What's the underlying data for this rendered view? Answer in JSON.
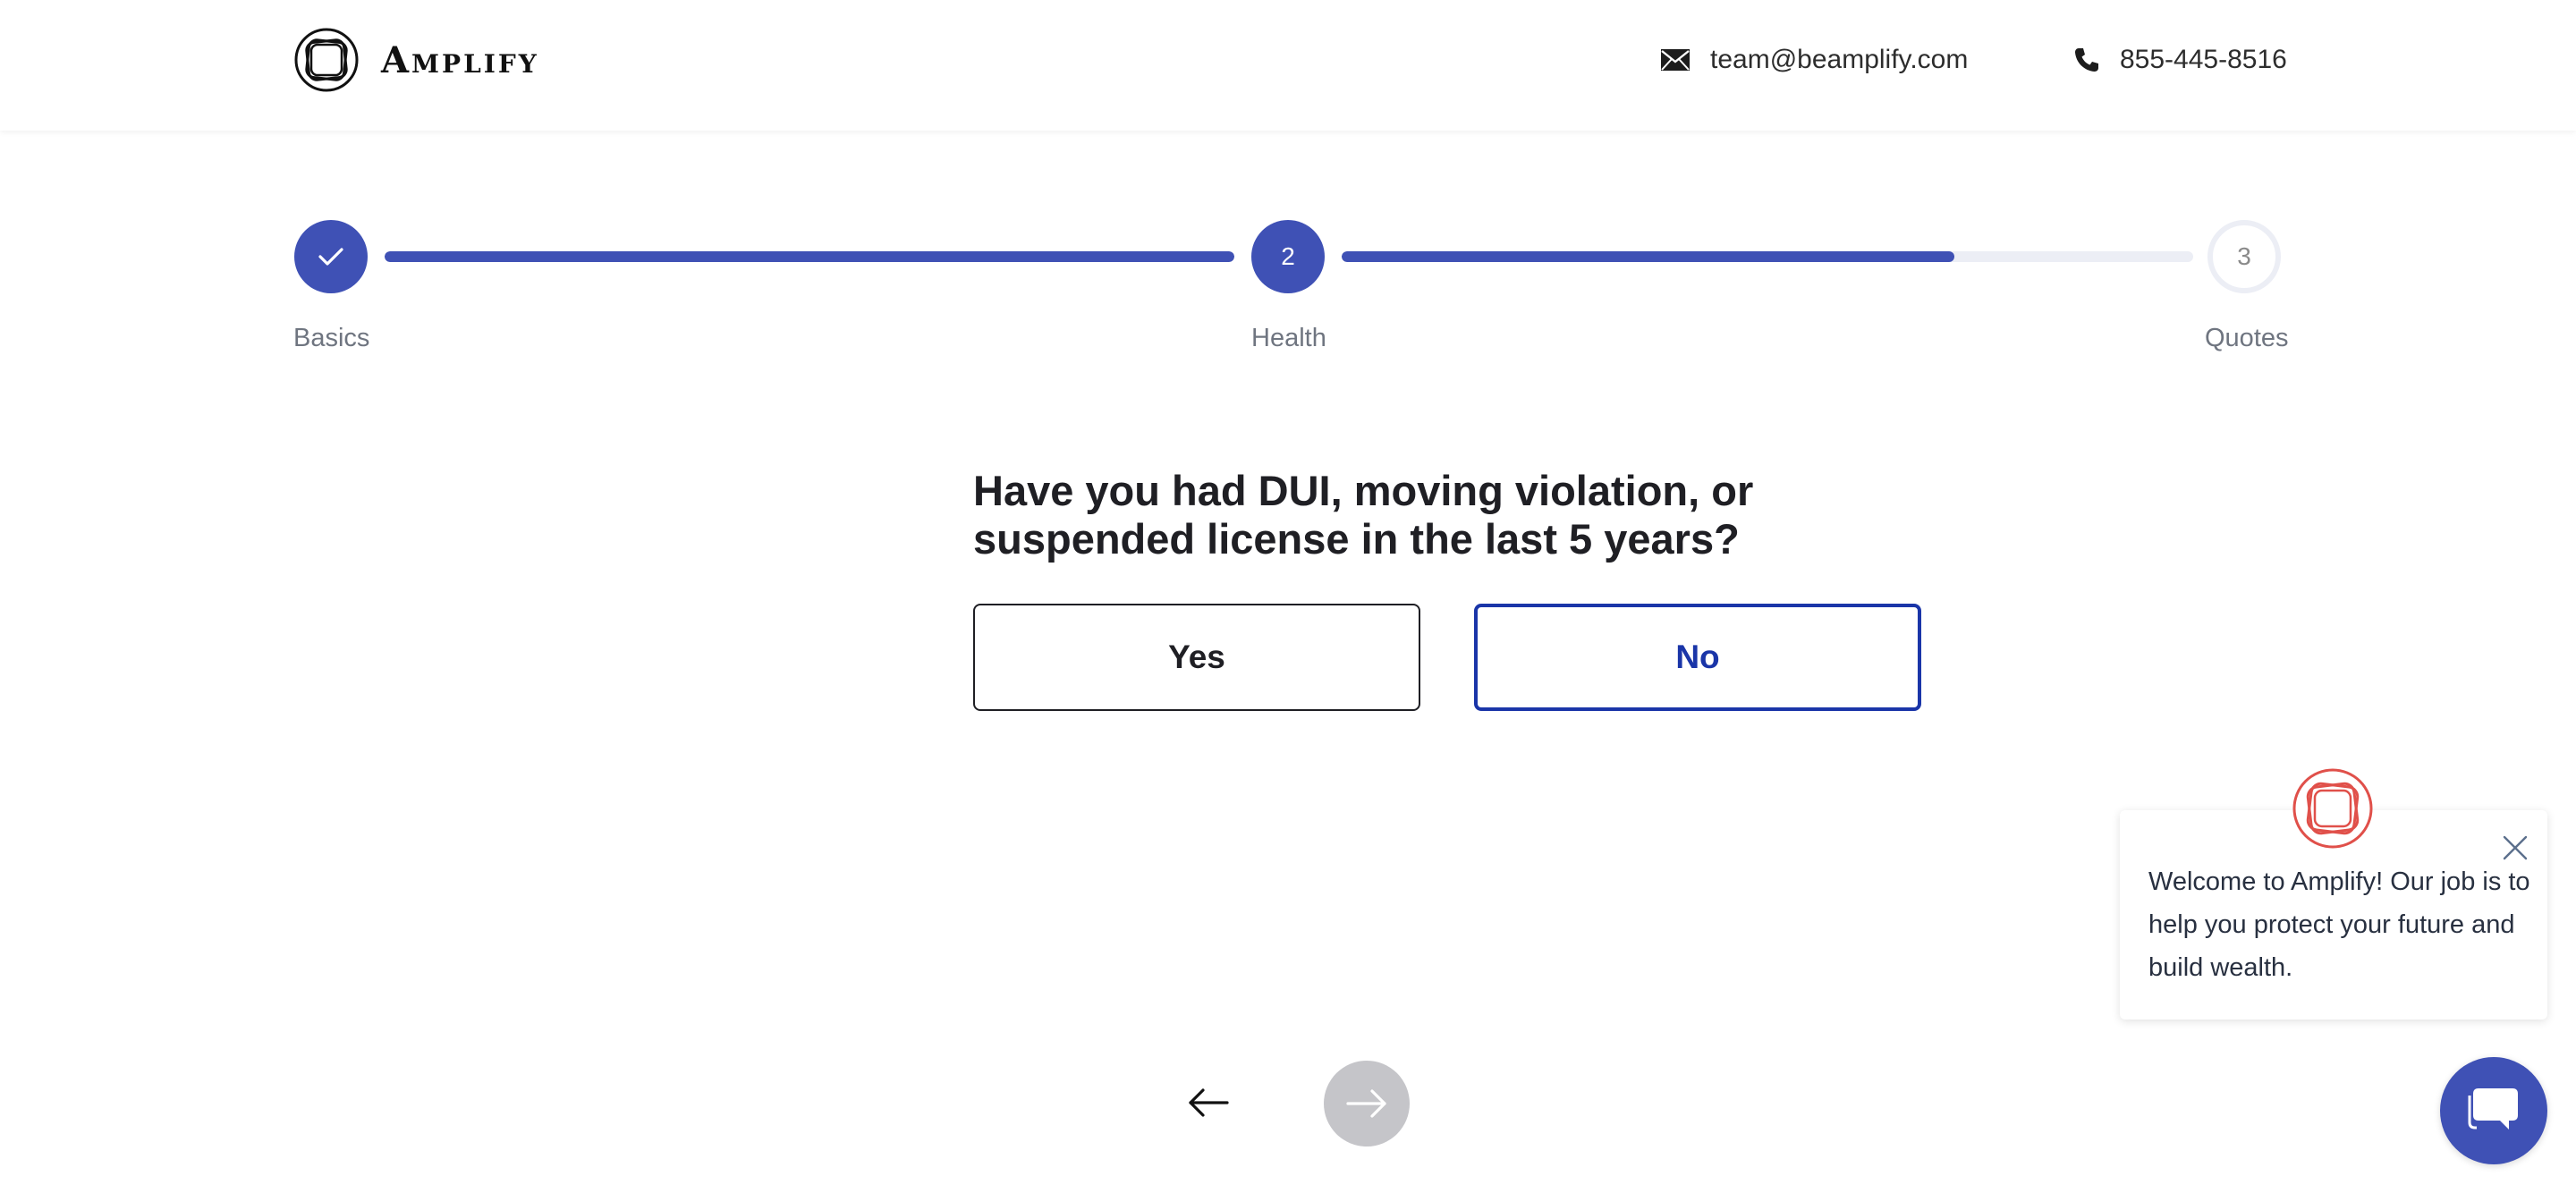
{
  "header": {
    "brand": "Amplify",
    "email": "team@beamplify.com",
    "phone": "855-445-8516"
  },
  "stepper": {
    "steps": [
      {
        "label": "Basics",
        "number": "",
        "state": "done"
      },
      {
        "label": "Health",
        "number": "2",
        "state": "active"
      },
      {
        "label": "Quotes",
        "number": "3",
        "state": "todo"
      }
    ],
    "progress": [
      1.0,
      0.72
    ]
  },
  "question": {
    "text": "Have you had DUI, moving violation, or suspended license in the last 5 years?",
    "options": [
      {
        "label": "Yes",
        "selected": false
      },
      {
        "label": "No",
        "selected": true
      }
    ]
  },
  "chat": {
    "message": "Welcome to Amplify! Our job is to help you protect your future and build wealth."
  },
  "icons": {
    "logo": "amplify-logo-icon",
    "email": "envelope-icon",
    "phone": "phone-icon",
    "check": "check-icon",
    "back": "arrow-left-icon",
    "next": "arrow-right-icon",
    "close": "close-icon",
    "chat": "chat-bubble-icon"
  },
  "colors": {
    "primary": "#3f51b5",
    "selected": "#1a35a8",
    "track": "#eceef5",
    "disabled": "#c5c5c9",
    "avatar": "#e0504a"
  }
}
